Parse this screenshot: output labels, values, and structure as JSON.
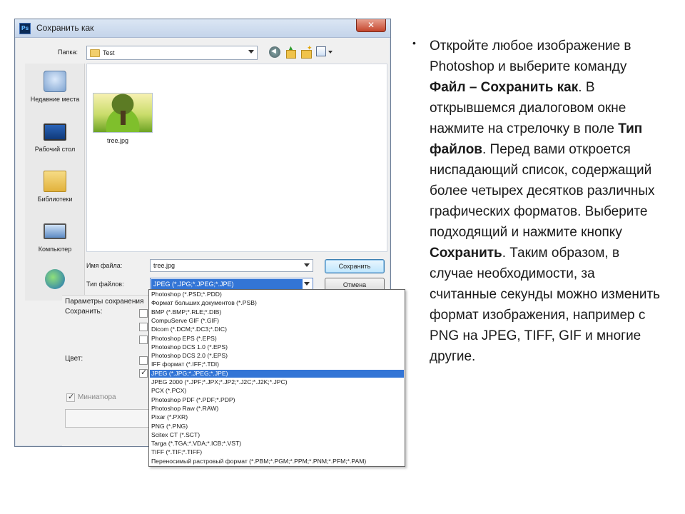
{
  "dialog": {
    "app_icon_text": "Ps",
    "title": "Сохранить как",
    "close_symbol": "✕",
    "folder_label": "Папка:",
    "folder_value": "Test",
    "places": [
      {
        "label": "Недавние места",
        "icon": "recent-places-icon"
      },
      {
        "label": "Рабочий стол",
        "icon": "desktop-icon"
      },
      {
        "label": "Библиотеки",
        "icon": "libraries-icon"
      },
      {
        "label": "Компьютер",
        "icon": "computer-icon"
      },
      {
        "label": "",
        "icon": "network-icon"
      }
    ],
    "file": {
      "name": "tree.jpg"
    },
    "filename_label": "Имя файла:",
    "filename_value": "tree.jpg",
    "filetype_label": "Тип файлов:",
    "filetype_value": "JPEG (*.JPG;*.JPEG;*.JPE)",
    "save_button": "Сохранить",
    "cancel_button": "Отмена",
    "params_label": "Параметры сохранения",
    "save_label": "Сохранить:",
    "color_label": "Цвет:",
    "thumbnail_label": "Миниатюра"
  },
  "type_options": [
    "Photoshop (*.PSD;*.PDD)",
    "Формат больших документов (*.PSB)",
    "BMP (*.BMP;*.RLE;*.DIB)",
    "CompuServe GIF (*.GIF)",
    "Dicom (*.DCM;*.DC3;*.DIC)",
    "Photoshop EPS (*.EPS)",
    "Photoshop DCS 1.0 (*.EPS)",
    "Photoshop DCS 2.0 (*.EPS)",
    "IFF формат (*.IFF;*.TDI)",
    "JPEG (*.JPG;*.JPEG;*.JPE)",
    "JPEG 2000 (*.JPF;*.JPX;*.JP2;*.J2C;*.J2K;*.JPC)",
    "PCX (*.PCX)",
    "Photoshop PDF (*.PDF;*.PDP)",
    "Photoshop Raw (*.RAW)",
    "Pixar (*.PXR)",
    "PNG (*.PNG)",
    "Scitex CT (*.SCT)",
    "Targa (*.TGA;*.VDA;*.ICB;*.VST)",
    "TIFF (*.TIF;*.TIFF)",
    "Переносимый растровый формат (*.PBM;*.PGM;*.PPM;*.PNM;*.PFM;*.PAM)"
  ],
  "selected_option_index": 9,
  "instruction": {
    "bullet": "•",
    "t1": "Откройте любое изображение в Photoshop и выберите команду ",
    "b1": "Файл – Сохранить как",
    "t2": ". В открывшемся диалоговом окне нажмите на стрелочку в поле ",
    "b2": "Тип файлов",
    "t3": ". Перед вами откроется ниспадающий список, содержащий более четырех десятков различных графических форматов. Выберите подходящий и нажмите кнопку ",
    "b3": "Сохранить",
    "t4": ". Таким образом, в случае необходимости, за считанные секунды можно изменить формат изображения, например с PNG на JPEG, TIFF, GIF и многие другие."
  },
  "colors": {
    "selection": "#3375d6",
    "titlebar": "#c4d4ea",
    "close": "#c4452c"
  }
}
